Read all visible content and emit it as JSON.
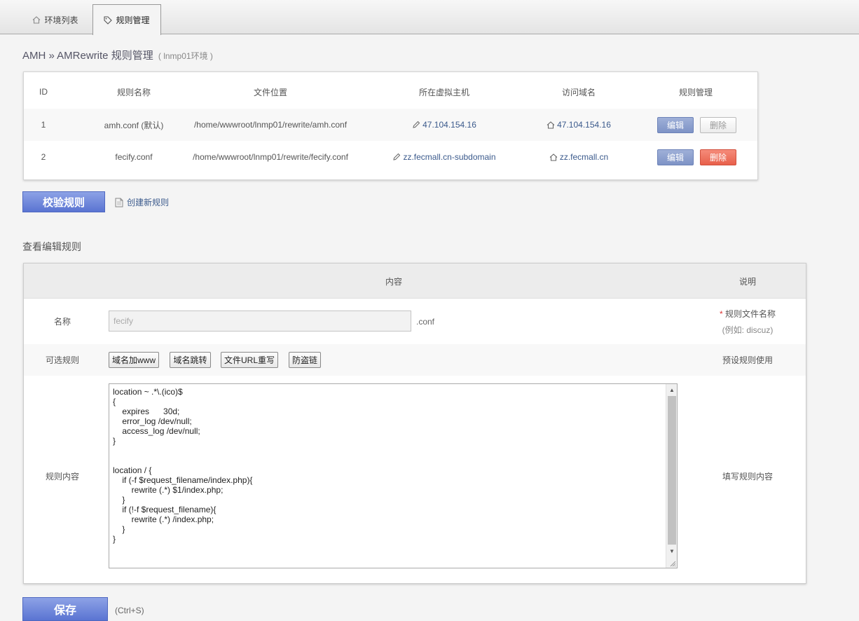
{
  "tabs": [
    {
      "label": "环境列表",
      "active": false
    },
    {
      "label": "规则管理",
      "active": true
    }
  ],
  "breadcrumb": {
    "text": "AMH » AMRewrite 规则管理",
    "env": "( lnmp01环境 )"
  },
  "rules_table": {
    "headers": [
      "ID",
      "规则名称",
      "文件位置",
      "所在虚拟主机",
      "访问域名",
      "规则管理"
    ],
    "rows": [
      {
        "id": "1",
        "name": "amh.conf  (默认)",
        "file": "/home/wwwroot/lnmp01/rewrite/amh.conf",
        "host": "47.104.154.16",
        "domain": "47.104.154.16",
        "edit": "编辑",
        "delete": "删除",
        "delete_enabled": false
      },
      {
        "id": "2",
        "name": "fecify.conf",
        "file": "/home/wwwroot/lnmp01/rewrite/fecify.conf",
        "host": "zz.fecmall.cn-subdomain",
        "domain": "zz.fecmall.cn",
        "edit": "编辑",
        "delete": "删除",
        "delete_enabled": true
      }
    ]
  },
  "actions": {
    "verify": "校验规则",
    "create": "创建新规则"
  },
  "editor": {
    "section_title": "查看编辑规则",
    "header_content": "内容",
    "header_desc": "说明",
    "name_label": "名称",
    "name_value": "fecify",
    "name_suffix": ".conf",
    "name_desc_star": "*",
    "name_desc": "规则文件名称",
    "name_desc_example": "(例如: discuz)",
    "optional_label": "可选规则",
    "optional_buttons": [
      "域名加www",
      "域名跳转",
      "文件URL重写",
      "防盗链"
    ],
    "optional_desc": "预设规则使用",
    "content_label": "规则内容",
    "content": "location ~ .*\\.(ico)$\n{\n    expires      30d;\n    error_log /dev/null;\n    access_log /dev/null;\n}\n\n\nlocation / {\n    if (-f $request_filename/index.php){\n        rewrite (.*) $1/index.php;\n    }\n    if (!-f $request_filename){\n        rewrite (.*) /index.php;\n    }\n}",
    "content_desc": "填写规则内容"
  },
  "footer": {
    "save": "保存",
    "hint": "(Ctrl+S)"
  },
  "colors": {
    "link": "#3b5a8c",
    "primary": "#5a74d2",
    "danger": "#e8604b",
    "required": "#dd3333"
  }
}
